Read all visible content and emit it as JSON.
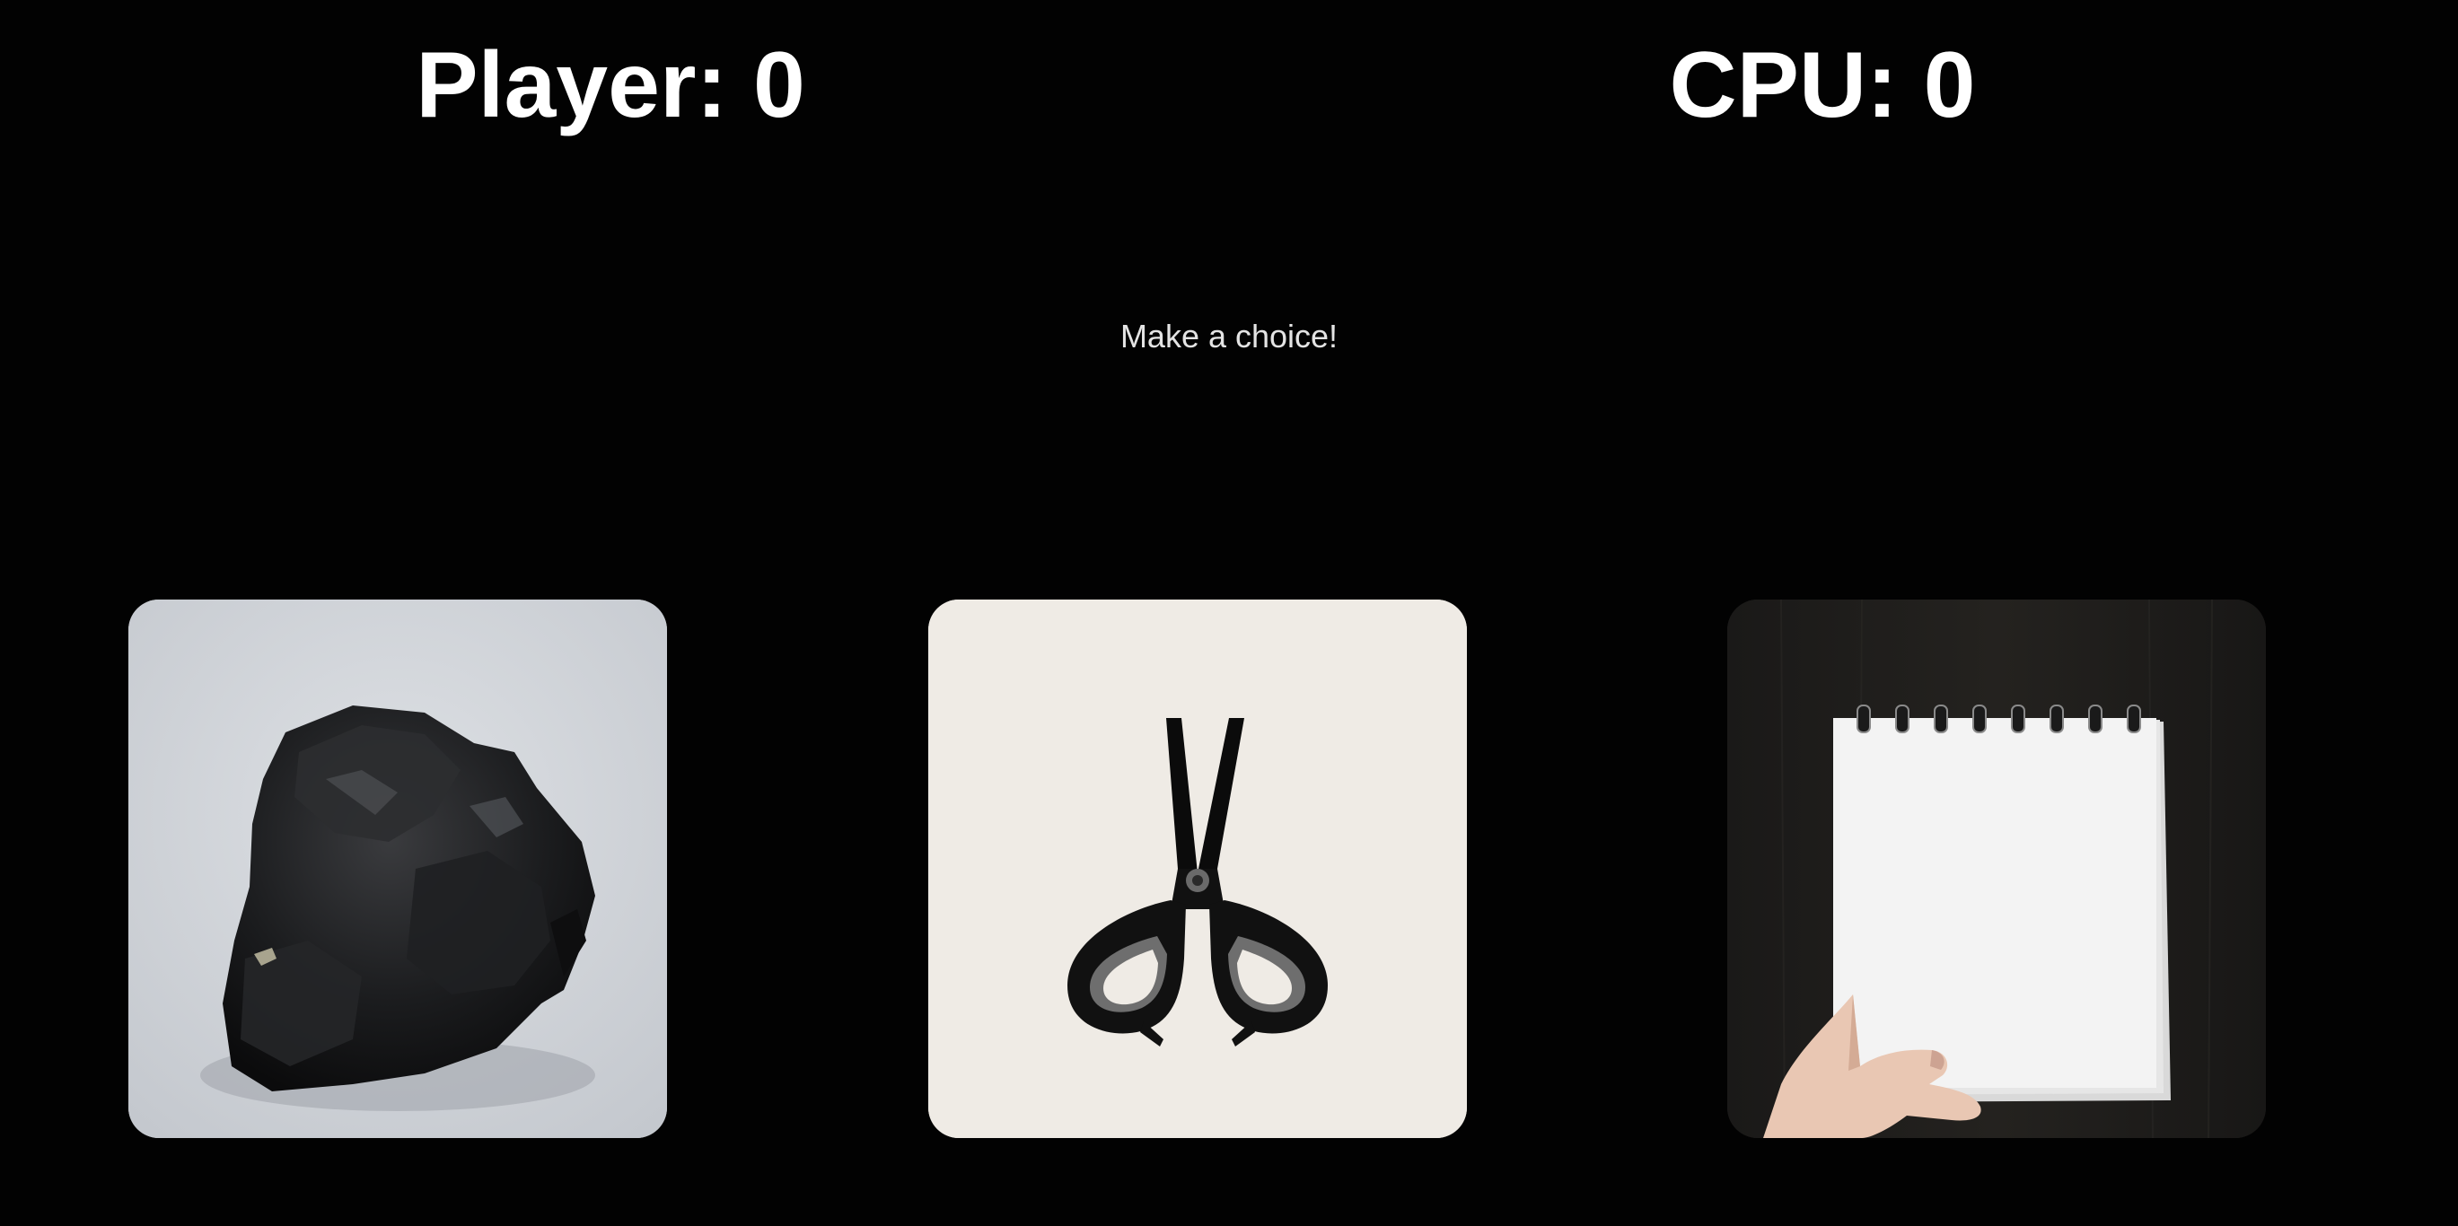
{
  "scoreboard": {
    "player": "Player: 0",
    "cpu": "CPU: 0"
  },
  "status": {
    "message": "Make a choice!"
  },
  "choices": [
    {
      "id": "rock",
      "icon": "rock-icon"
    },
    {
      "id": "scissors",
      "icon": "scissors-icon"
    },
    {
      "id": "paper",
      "icon": "paper-icon"
    }
  ]
}
